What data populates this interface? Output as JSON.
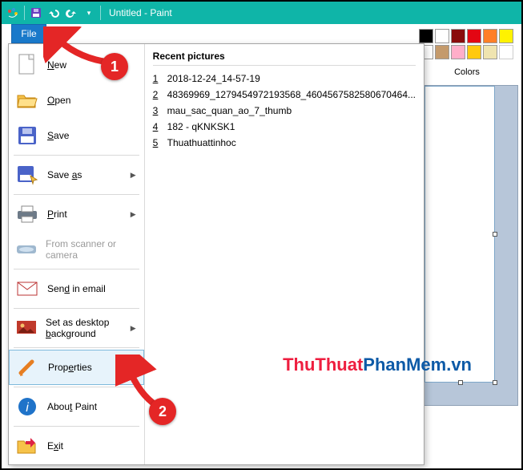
{
  "titlebar": {
    "title": "Untitled - Paint"
  },
  "file_button": {
    "label": "File"
  },
  "menu": {
    "new": {
      "label": "New",
      "key": "N"
    },
    "open": {
      "label": "Open",
      "key": "O"
    },
    "save": {
      "label": "Save",
      "key": "S"
    },
    "saveas": {
      "label": "Save as",
      "key": "a"
    },
    "print": {
      "label": "Print",
      "key": "P"
    },
    "scan": {
      "label": "From scanner or camera"
    },
    "send": {
      "label": "Send in email",
      "key": "d"
    },
    "bg": {
      "label": "Set as desktop background",
      "key": "b"
    },
    "props": {
      "label": "Properties",
      "key": "e"
    },
    "about": {
      "label": "About Paint",
      "key": "t"
    },
    "exit": {
      "label": "Exit",
      "key": "x"
    }
  },
  "recent": {
    "title": "Recent pictures",
    "items": [
      {
        "num": "1",
        "name": "2018-12-24_14-57-19"
      },
      {
        "num": "2",
        "name": "48369969_1279454972193568_4604567582580670464..."
      },
      {
        "num": "3",
        "name": "mau_sac_quan_ao_7_thumb"
      },
      {
        "num": "4",
        "name": "182 - qKNKSK1"
      },
      {
        "num": "5",
        "name": "Thuathuattinhoc"
      }
    ]
  },
  "colors": {
    "label": "Colors",
    "row1": [
      "#000000",
      "#ffffff",
      "#8a0b0b",
      "#e30613",
      "#ff7f27",
      "#fff200"
    ],
    "row2": [
      "#ffffff",
      "#c49a6c",
      "#ffaec9",
      "#ffc90e",
      "#efe4b0",
      null
    ]
  },
  "annotations": {
    "one": "1",
    "two": "2"
  },
  "watermark": {
    "a": "ThuThuat",
    "b": "PhanMem",
    "suf": ".vn"
  }
}
